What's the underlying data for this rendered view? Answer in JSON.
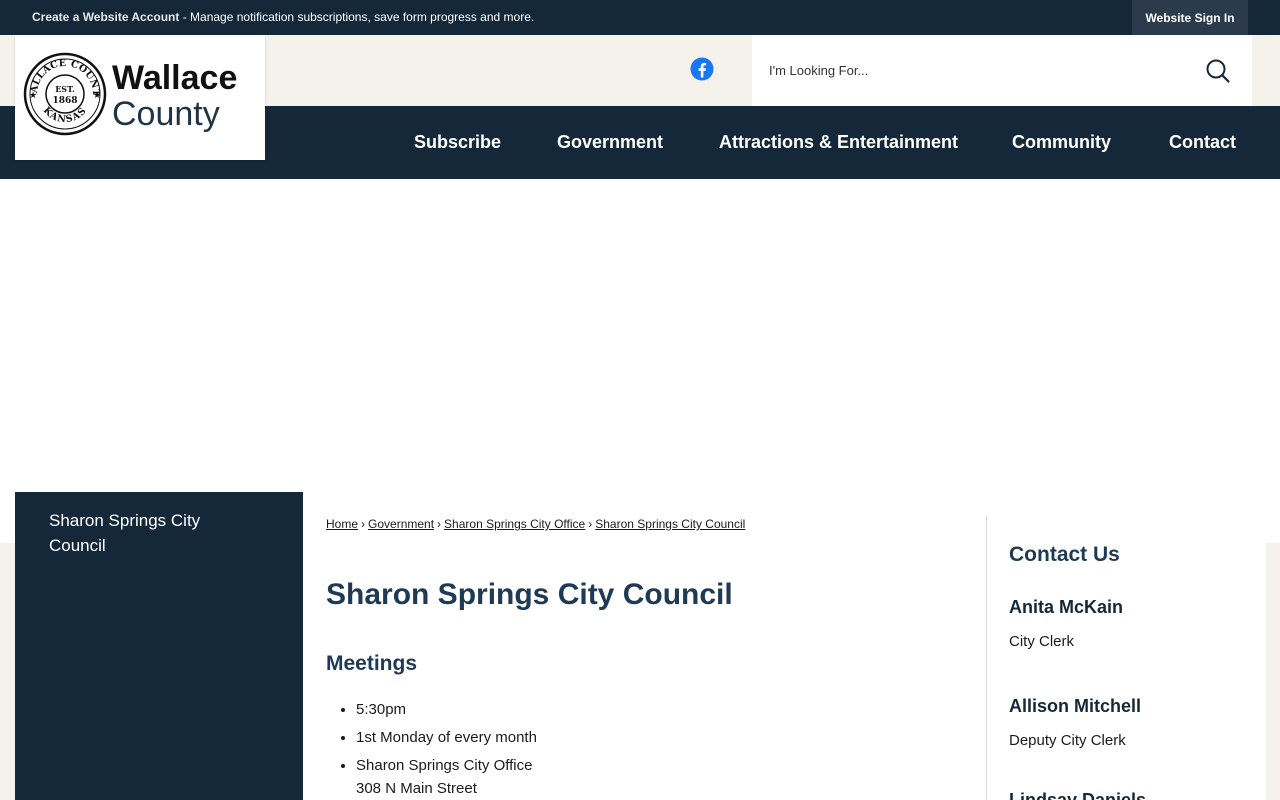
{
  "topbar": {
    "account_link": "Create a Website Account",
    "account_message": " - Manage notification subscriptions, save form progress and more.",
    "signin_label": "Website Sign In"
  },
  "logo": {
    "seal_text_top": "WALLACE COUNTY",
    "seal_text_bottom": "KANSAS",
    "seal_est": "EST.",
    "seal_year": "1868",
    "title": "Wallace",
    "subtitle": "County"
  },
  "social": {
    "facebook_icon": "facebook-icon",
    "facebook_color": "#1877f2"
  },
  "search": {
    "placeholder": "I'm Looking For...",
    "icon": "search-icon"
  },
  "nav": {
    "items": [
      {
        "label": "Subscribe"
      },
      {
        "label": "Government"
      },
      {
        "label": "Attractions & Entertainment"
      },
      {
        "label": "Community"
      },
      {
        "label": "Contact"
      }
    ]
  },
  "sidebar": {
    "items": [
      {
        "label": "Sharon Springs City Council"
      }
    ]
  },
  "breadcrumb": {
    "items": [
      {
        "label": "Home"
      },
      {
        "label": "Government"
      },
      {
        "label": "Sharon Springs City Office"
      },
      {
        "label": "Sharon Springs City Council"
      }
    ],
    "separator": "›"
  },
  "main": {
    "title": "Sharon Springs City Council",
    "meetings_heading": "Meetings",
    "meetings": {
      "time": "5:30pm",
      "schedule": "1st Monday of every month",
      "location_name": "Sharon Springs City Office",
      "location_address": "308 N Main Street"
    }
  },
  "contact": {
    "heading": "Contact Us",
    "people": [
      {
        "name": "Anita McKain",
        "role": "City Clerk"
      },
      {
        "name": "Allison Mitchell",
        "role": "Deputy City Clerk"
      },
      {
        "name": "Lindsay Daniels",
        "role": ""
      }
    ]
  },
  "colors": {
    "navy": "#14283a",
    "heading_blue": "#1f3a55",
    "cream": "#f5f2ec"
  }
}
